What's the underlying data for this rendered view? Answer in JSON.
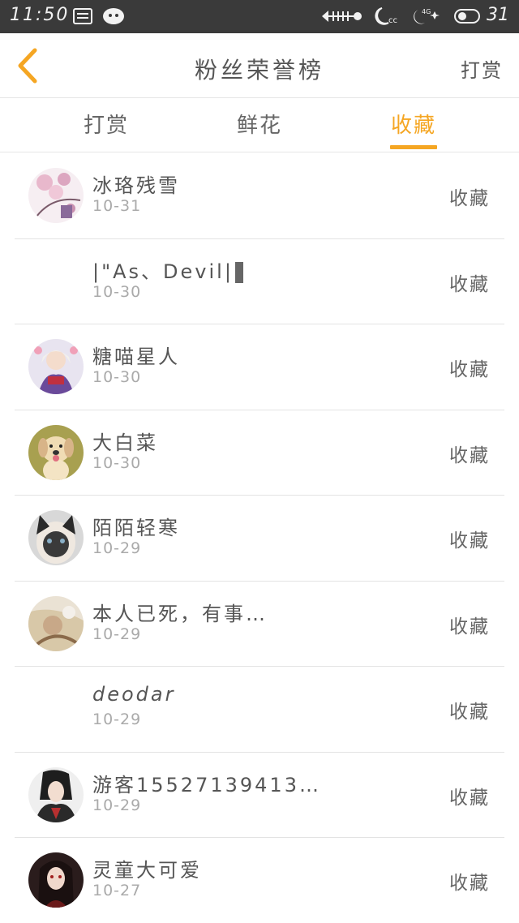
{
  "status_bar": {
    "time": "11:50",
    "battery_level": "31",
    "network": "4G",
    "icons": [
      "message-icon",
      "wechat-icon",
      "fish-icon",
      "moon-icon",
      "night-mode-icon",
      "battery-icon"
    ]
  },
  "header": {
    "title": "粉丝荣誉榜",
    "right_link": "打赏",
    "back_icon": "chevron-left-icon",
    "accent": "#f5a623"
  },
  "tabs": [
    {
      "label": "打赏",
      "active": false
    },
    {
      "label": "鲜花",
      "active": false
    },
    {
      "label": "收藏",
      "active": true
    }
  ],
  "rows": [
    {
      "name": "冰珞残雪",
      "date": "10-31",
      "action": "收藏",
      "avatar": "pink-blossom"
    },
    {
      "name": "|\"As、Devil|",
      "date": "10-30",
      "action": "收藏",
      "avatar": "none"
    },
    {
      "name": "糖喵星人",
      "date": "10-30",
      "action": "收藏",
      "avatar": "anime-girl"
    },
    {
      "name": "大白菜",
      "date": "10-30",
      "action": "收藏",
      "avatar": "puppy"
    },
    {
      "name": "陌陌轻寒",
      "date": "10-29",
      "action": "收藏",
      "avatar": "cat"
    },
    {
      "name": "本人已死，有事…",
      "date": "10-29",
      "action": "收藏",
      "avatar": "painting"
    },
    {
      "name": "deodar",
      "date": "10-29",
      "action": "收藏",
      "avatar": "none"
    },
    {
      "name": "游客15527139413…",
      "date": "10-29",
      "action": "收藏",
      "avatar": "anime-boy"
    },
    {
      "name": "灵童大可爱",
      "date": "10-27",
      "action": "收藏",
      "avatar": "anime-dark"
    }
  ]
}
